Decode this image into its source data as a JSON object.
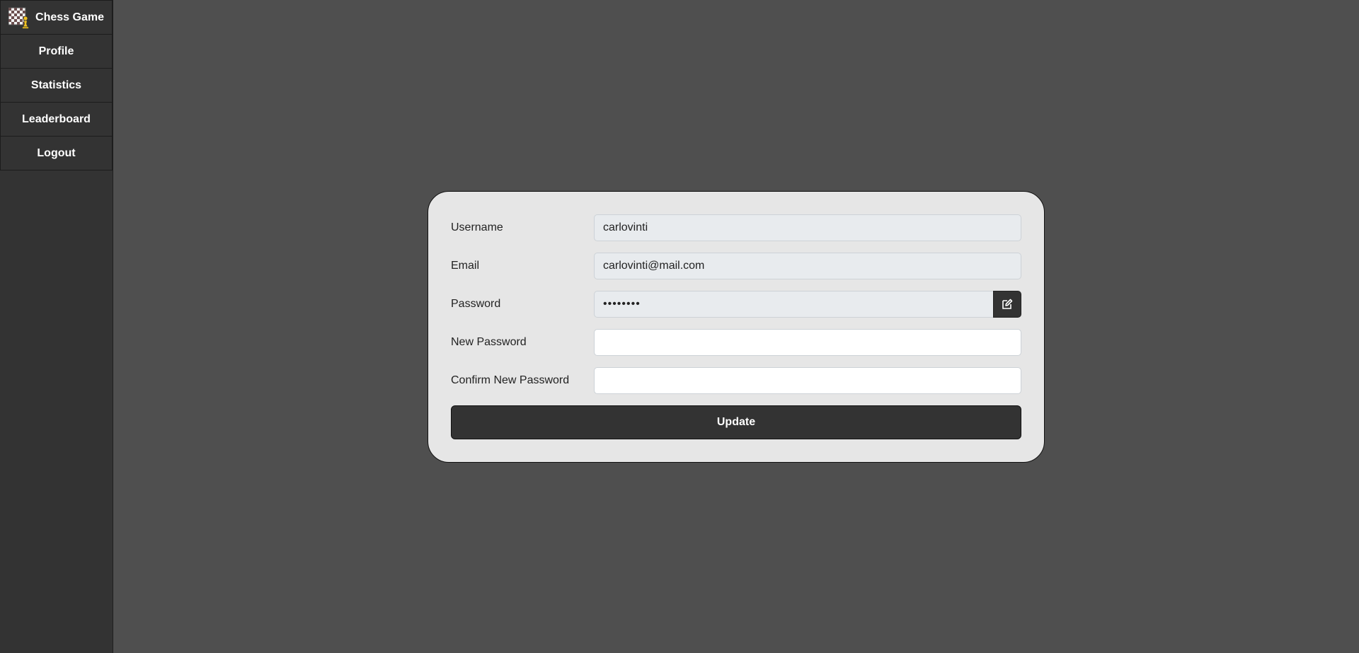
{
  "sidebar": {
    "brand": {
      "title": "Chess Game",
      "icon": "chess-logo-icon"
    },
    "items": [
      {
        "label": "Profile"
      },
      {
        "label": "Statistics"
      },
      {
        "label": "Leaderboard"
      },
      {
        "label": "Logout"
      }
    ]
  },
  "form": {
    "username": {
      "label": "Username",
      "value": "carlovinti"
    },
    "email": {
      "label": "Email",
      "value": "carlovinti@mail.com"
    },
    "password": {
      "label": "Password",
      "value": "••••••••",
      "edit_icon": "edit-icon"
    },
    "new_password": {
      "label": "New Password",
      "value": ""
    },
    "confirm_password": {
      "label": "Confirm New Password",
      "value": ""
    },
    "submit_label": "Update"
  },
  "colors": {
    "background": "#4f4f4f",
    "sidebar": "#333333",
    "card": "#e6e6e6",
    "button": "#333333"
  }
}
